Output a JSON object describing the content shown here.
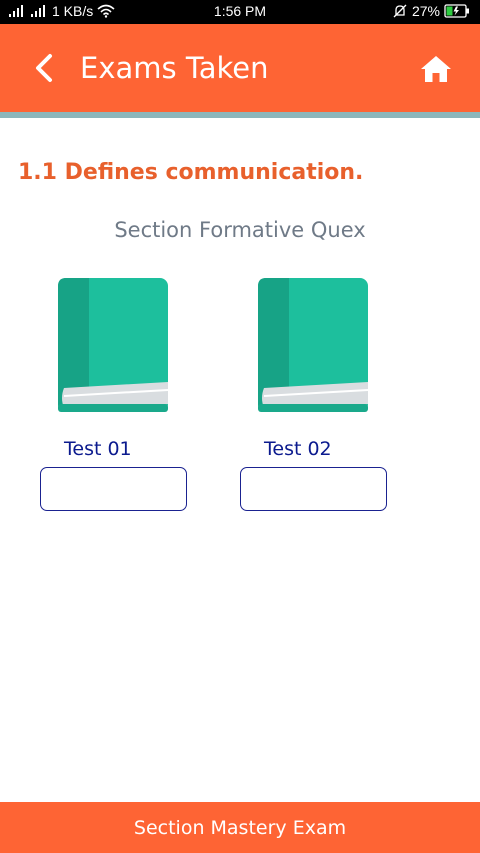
{
  "status_bar": {
    "network_speed": "1 KB/s",
    "time": "1:56 PM",
    "battery_percent": "27%",
    "icons": [
      "signal-icon",
      "signal-icon",
      "wifi-icon",
      "alarm-off-icon",
      "battery-charging-icon"
    ]
  },
  "header": {
    "title": "Exams Taken",
    "back_icon": "chevron-left-icon",
    "home_icon": "home-icon"
  },
  "content": {
    "section_heading": "1.1 Defines communication.",
    "subheading": "Section Formative Quex",
    "tests": [
      {
        "label": "Test 01",
        "score_value": "",
        "icon": "book-icon"
      },
      {
        "label": "Test 02",
        "score_value": "",
        "icon": "book-icon"
      }
    ]
  },
  "footer": {
    "button_label": "Section Mastery Exam"
  },
  "colors": {
    "accent": "#fe6434",
    "divider": "#8cb6bb",
    "heading": "#e8602c",
    "subheading": "#6f7a87",
    "test_label": "#0b1a8e",
    "book_cover": "#1dbf9d",
    "book_spine": "#17a386",
    "book_pages": "#d9dde0"
  }
}
